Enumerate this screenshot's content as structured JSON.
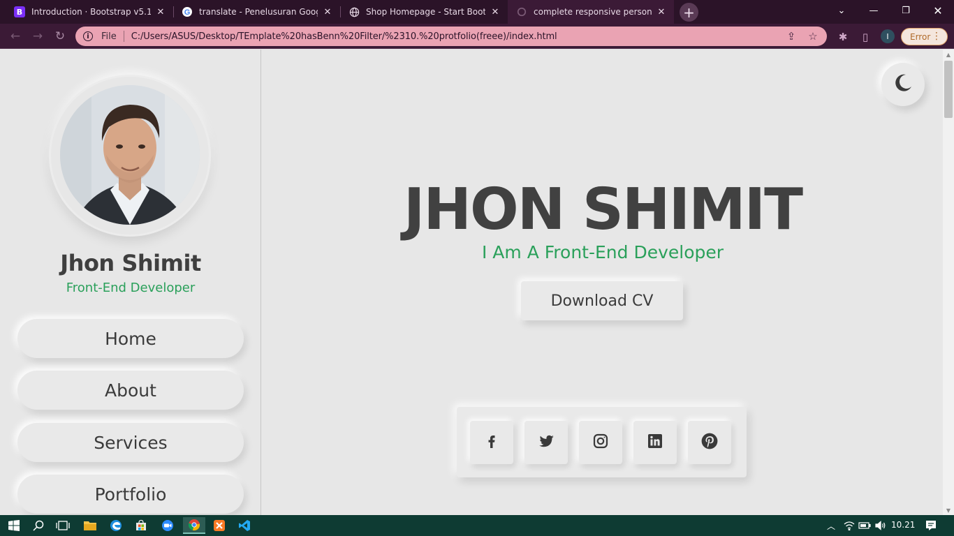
{
  "browser": {
    "tabs": [
      {
        "title": "Introduction · Bootstrap v5.1",
        "favicon": "bootstrap-icon"
      },
      {
        "title": "translate - Penelusuran Google",
        "favicon": "google-icon"
      },
      {
        "title": "Shop Homepage - Start Bootstrap",
        "favicon": "globe-icon"
      },
      {
        "title": "complete responsive personal portfolio",
        "favicon": "loading-icon"
      }
    ],
    "new_tab_label": "+",
    "address": {
      "scheme_label": "File",
      "url": "C:/Users/ASUS/Desktop/TEmplate%20hasBenn%20Filter/%2310.%20protfolio(freee)/index.html"
    },
    "profile_initial": "I",
    "error_label": "Error"
  },
  "sidebar": {
    "name": "Jhon Shimit",
    "role": "Front-End Developer",
    "nav": [
      {
        "label": "Home"
      },
      {
        "label": "About"
      },
      {
        "label": "Services"
      },
      {
        "label": "Portfolio"
      }
    ]
  },
  "hero": {
    "name": "JHON SHIMIT",
    "tagline": "I Am A Front-End Developer",
    "cv_button": "Download CV"
  },
  "socials": [
    "facebook-icon",
    "twitter-icon",
    "instagram-icon",
    "linkedin-icon",
    "pinterest-icon"
  ],
  "taskbar": {
    "time": "10.21"
  },
  "colors": {
    "accent": "#2aa05a",
    "page_bg": "#e7e7e7",
    "text": "#3f3f3f",
    "browser_frame": "#2b1328",
    "omnibox": "#eaa3b3"
  }
}
